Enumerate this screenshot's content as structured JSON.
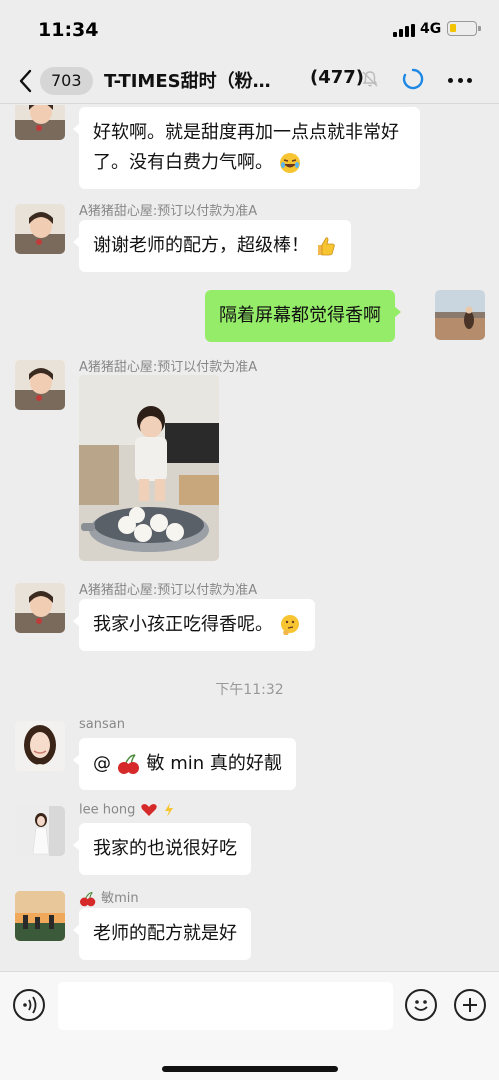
{
  "status_bar": {
    "time": "11:34",
    "network": "4G"
  },
  "nav": {
    "unread_count": "703",
    "title": "T-TIMES甜时（粉…",
    "member_count": "(477)"
  },
  "messages": [
    {
      "side": "left",
      "sender": "",
      "text": "好软啊。就是甜度再加一点点就非常好了。没有白费力气啊。",
      "emoji": "laughing-tears-emoji"
    },
    {
      "side": "left",
      "sender": "A猪猪甜心屋:预订以付款为准A",
      "text": "谢谢老师的配方，超级棒！",
      "emoji": "thumbs-up-emoji"
    },
    {
      "side": "right",
      "text": "隔着屏幕都觉得香啊"
    },
    {
      "side": "left",
      "sender": "A猪猪甜心屋:预订以付款为准A",
      "type": "image"
    },
    {
      "side": "left",
      "sender": "A猪猪甜心屋:预订以付款为准A",
      "text": "我家小孩正吃得香呢。",
      "emoji": "thinking-emoji"
    },
    {
      "type": "timestamp",
      "text": "下午11:32"
    },
    {
      "side": "left",
      "sender": "sansan",
      "text_prefix": "@",
      "text": "敏 min 真的好靓",
      "emoji": "cherry-emoji"
    },
    {
      "side": "left",
      "sender": "lee hong",
      "text": "我家的也说很好吃",
      "emoji": "heart-lightning-emoji"
    },
    {
      "side": "left",
      "sender": "敏min",
      "text": "老师的配方就是好",
      "emoji": "cherry-emoji"
    }
  ],
  "colors": {
    "accent_green": "#95ec69",
    "background": "#ededed",
    "sync_blue": "#1e88e5"
  }
}
